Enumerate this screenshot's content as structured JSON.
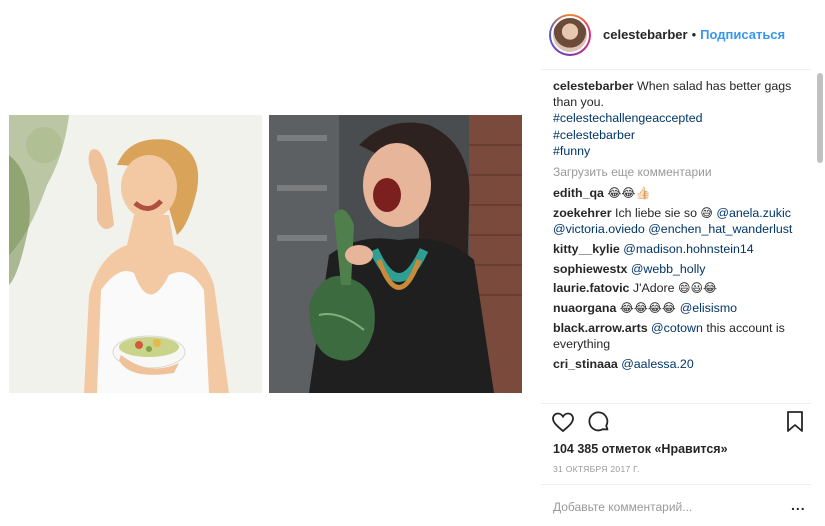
{
  "post": {
    "images": [
      "woman-laughing-with-salad-photo",
      "woman-laughing-with-kale-photo"
    ]
  },
  "header": {
    "username": "celestebarber",
    "separator": "•",
    "follow_label": "Подписаться"
  },
  "caption": {
    "username": "celestebarber",
    "text": "When salad has better gags than you.",
    "hashtags": [
      "#celestechallengeaccepted",
      "#celestebarber",
      "#funny"
    ]
  },
  "load_more": "Загрузить еще комментарии",
  "comments": [
    {
      "user": "edith_qa",
      "parts": [
        {
          "t": "😂😂👍🏻",
          "k": "emoji"
        }
      ]
    },
    {
      "user": "zoekehrer",
      "parts": [
        {
          "t": "Ich liebe sie so ",
          "k": "text"
        },
        {
          "t": "😅",
          "k": "emoji"
        },
        {
          "t": " @anela.zukic @victoria.oviedo @enchen_hat_wanderlust",
          "k": "link"
        }
      ]
    },
    {
      "user": "kitty__kylie",
      "parts": [
        {
          "t": "@madison.hohnstein14",
          "k": "link"
        }
      ]
    },
    {
      "user": "sophiewestx",
      "parts": [
        {
          "t": "@webb_holly",
          "k": "link"
        }
      ]
    },
    {
      "user": "laurie.fatovic",
      "parts": [
        {
          "t": "J'Adore ",
          "k": "text"
        },
        {
          "t": "😄😃😂",
          "k": "emoji"
        }
      ]
    },
    {
      "user": "nuaorgana",
      "parts": [
        {
          "t": "😂😂😂😂 ",
          "k": "emoji"
        },
        {
          "t": "@elisismo",
          "k": "link"
        }
      ]
    },
    {
      "user": "black.arrow.arts",
      "parts": [
        {
          "t": "@cotown",
          "k": "link"
        },
        {
          "t": " this account is everything",
          "k": "text"
        }
      ]
    },
    {
      "user": "cri_stinaaa",
      "parts": [
        {
          "t": "@aalessa.20",
          "k": "link"
        }
      ]
    }
  ],
  "actions": {
    "like_icon": "heart-icon",
    "comment_icon": "comment-icon",
    "save_icon": "bookmark-icon"
  },
  "likes": "104 385 отметок «Нравится»",
  "date": "31 ОКТЯБРЯ 2017 Г.",
  "add_comment": {
    "placeholder": "Добавьте комментарий...",
    "more_label": "..."
  },
  "colors": {
    "link": "#003569",
    "follow": "#3897f0",
    "muted": "#999999",
    "text": "#262626"
  }
}
